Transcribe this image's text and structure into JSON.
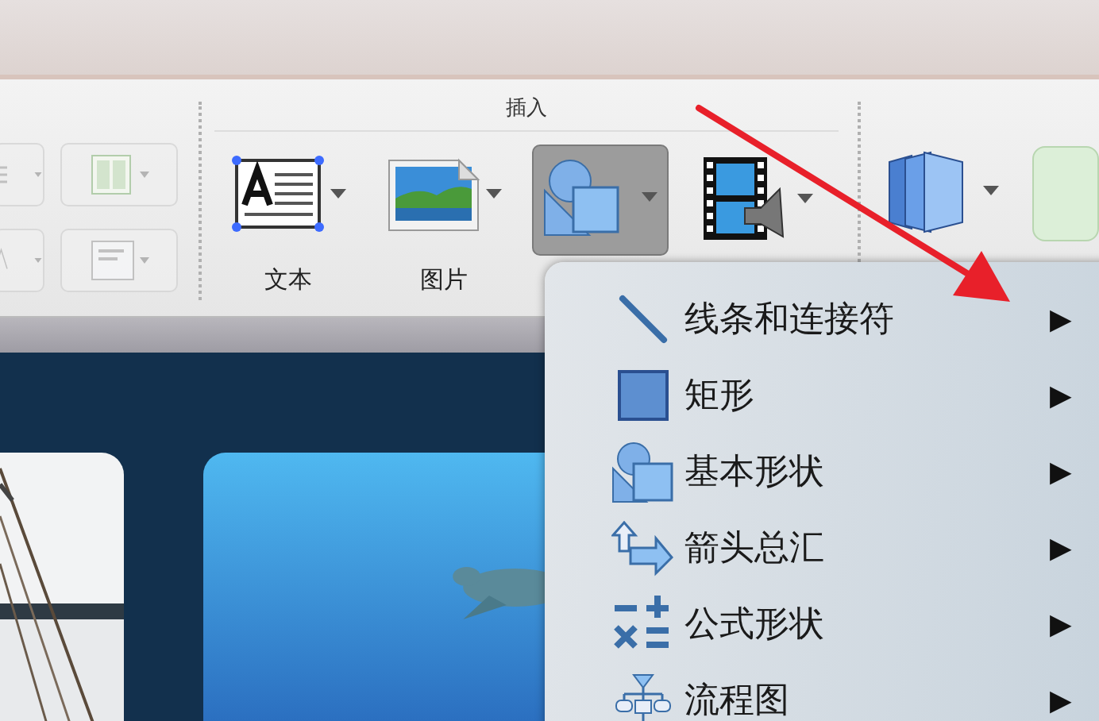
{
  "ribbon": {
    "left_controls": [
      {
        "kind": "list",
        "disabled": true
      },
      {
        "kind": "columns",
        "disabled": true
      },
      {
        "kind": "textstyle",
        "disabled": true
      },
      {
        "kind": "align",
        "disabled": true
      }
    ],
    "insert_group": {
      "title": "插入",
      "buttons": [
        {
          "kind": "textbox",
          "label": "文本",
          "selected": false
        },
        {
          "kind": "picture",
          "label": "图片",
          "selected": false
        },
        {
          "kind": "shapes",
          "selected": true
        },
        {
          "kind": "media",
          "selected": false
        }
      ]
    },
    "next_group": {
      "buttons": [
        {
          "kind": "book"
        },
        {
          "kind": "callout"
        }
      ]
    }
  },
  "menu": {
    "items": [
      {
        "kind": "line",
        "label": "线条和连接符",
        "submenu": "▶"
      },
      {
        "kind": "rectangle",
        "label": "矩形",
        "submenu": "▶"
      },
      {
        "kind": "basic",
        "label": "基本形状",
        "submenu": "▶"
      },
      {
        "kind": "arrows",
        "label": "箭头总汇",
        "submenu": "▶"
      },
      {
        "kind": "equation",
        "label": "公式形状",
        "submenu": "▶"
      },
      {
        "kind": "flowchart",
        "label": "流程图",
        "submenu": "▶"
      }
    ]
  }
}
